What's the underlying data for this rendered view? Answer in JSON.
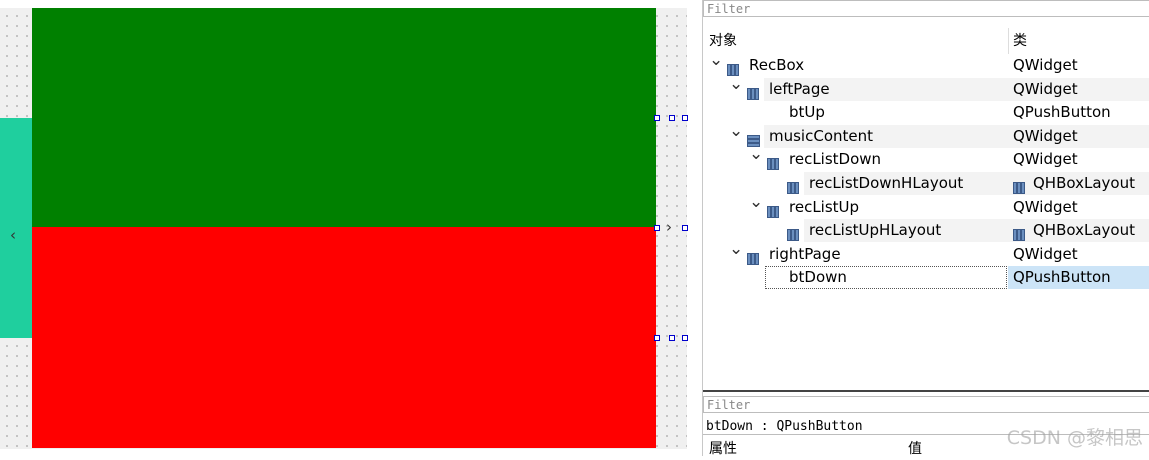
{
  "canvas": {
    "left_arrow": "‹",
    "right_arrow": "›",
    "colors": {
      "green": "#008000",
      "red": "#ff0000",
      "teal": "#1fcf9e"
    }
  },
  "inspector": {
    "filter_placeholder": "Filter",
    "header_object": "对象",
    "header_class": "类",
    "tree": [
      {
        "name": "RecBox",
        "cls": "QWidget",
        "expanded": true
      },
      {
        "name": "leftPage",
        "cls": "QWidget",
        "expanded": true
      },
      {
        "name": "btUp",
        "cls": "QPushButton"
      },
      {
        "name": "musicContent",
        "cls": "QWidget",
        "expanded": true
      },
      {
        "name": "recListDown",
        "cls": "QWidget",
        "expanded": true
      },
      {
        "name": "recListDownHLayout",
        "cls": "QHBoxLayout"
      },
      {
        "name": "recListUp",
        "cls": "QWidget",
        "expanded": true
      },
      {
        "name": "recListUpHLayout",
        "cls": "QHBoxLayout"
      },
      {
        "name": "rightPage",
        "cls": "QWidget",
        "expanded": true
      },
      {
        "name": "btDown",
        "cls": "QPushButton",
        "selected": true
      }
    ],
    "prop_filter_placeholder": "Filter",
    "prop_title": "btDown : QPushButton",
    "prop_header_property": "属性",
    "prop_header_value": "值"
  },
  "watermark": "CSDN @黎相思"
}
